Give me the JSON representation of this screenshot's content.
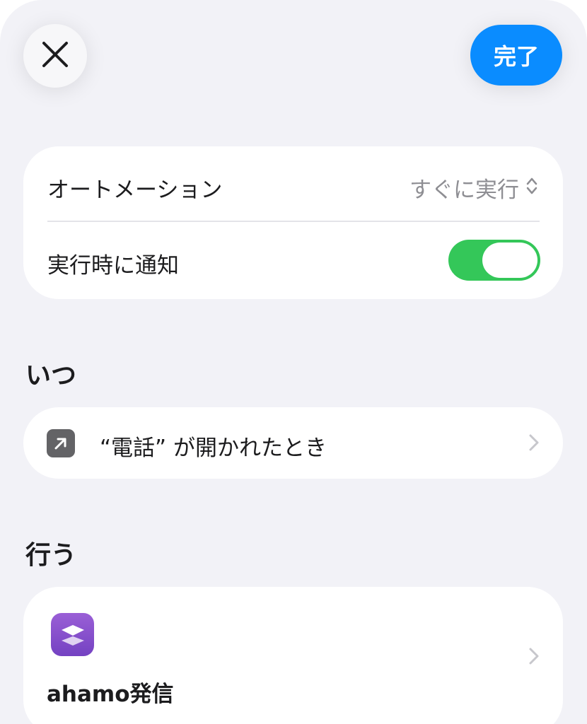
{
  "header": {
    "close_icon": "xmark-icon",
    "done_label": "完了",
    "done_color": "#0a8cff"
  },
  "settings": {
    "automation_label": "オートメーション",
    "automation_value": "すぐに実行",
    "automation_value_icon": "chevron-up-down-icon",
    "notify_label": "実行時に通知",
    "notify_enabled": true,
    "toggle_color": "#34c759"
  },
  "when": {
    "header": "いつ",
    "trigger_icon": "app-open-arrow-icon",
    "trigger_label": "“電話” が開かれたとき"
  },
  "do": {
    "header": "行う",
    "shortcut_icon": "shortcuts-layers-icon",
    "shortcut_name": "ahamo発信"
  }
}
